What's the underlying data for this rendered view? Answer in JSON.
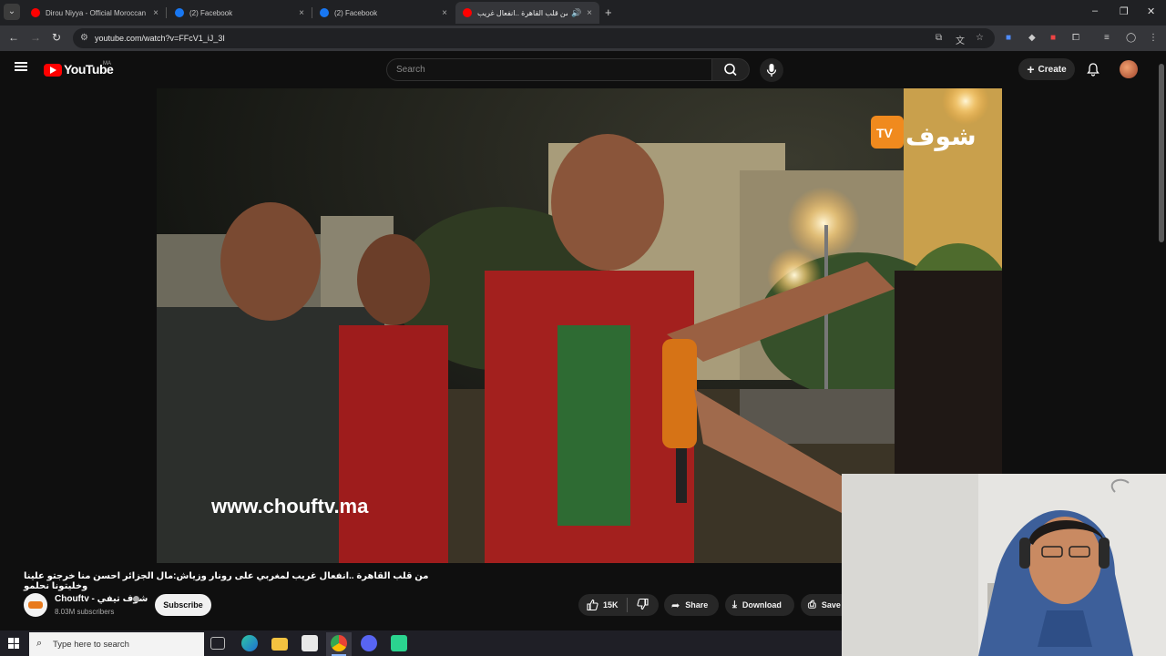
{
  "browser": {
    "tabs": [
      {
        "title": "Dirou Niyya - Official Moroccan",
        "favicon": "youtube-favicon",
        "color": "#ff0000"
      },
      {
        "title": "(2) Facebook",
        "favicon": "facebook-favicon",
        "color": "#1877f2"
      },
      {
        "title": "(2) Facebook",
        "favicon": "facebook-favicon",
        "color": "#1877f2"
      },
      {
        "title": "من قلب القاهرة ..انفعال غريب",
        "favicon": "youtube-favicon",
        "color": "#ff0000",
        "active": true
      }
    ],
    "close_glyph": "×",
    "new_tab_glyph": "+",
    "url": "youtube.com/watch?v=FFcV1_iJ_3I",
    "window_controls": [
      "–",
      "❐",
      "✕"
    ]
  },
  "youtube": {
    "logo_text": "YouTube",
    "country_code": "MA",
    "search_placeholder": "Search",
    "create_label": "Create",
    "create_glyph": "+"
  },
  "video": {
    "watermark_text": "www.chouftv.ma",
    "logo_brand": "شوف",
    "logo_tv": "TV",
    "title": "من قلب القاهرة ..انفعال غريب لمغربي على رونار وزياش:مال الجزائر احسن منا خرجتو علينا وخليتونا نحلمو",
    "channel_name": "Chouftv - شوف تيفي",
    "subscribers": "8.03M subscribers",
    "subscribe_label": "Subscribe",
    "likes": "15K",
    "share_label": "Share",
    "download_label": "Download",
    "save_label": "Save"
  },
  "taskbar": {
    "search_placeholder": "Type here to search"
  },
  "colors": {
    "background": "#0f0f0f",
    "youtube_red": "#ff0000",
    "pill_bg": "#272727"
  }
}
